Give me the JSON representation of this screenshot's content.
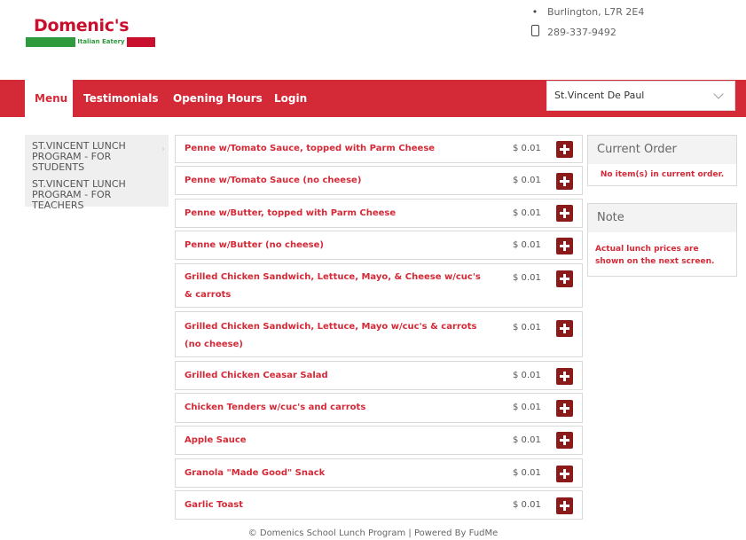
{
  "header": {
    "logo_name": "Domenic's",
    "logo_sub": "Italian Eatery",
    "address_icon": "pin-icon",
    "address": "Burlington, L7R 2E4",
    "phone_icon": "phone-icon",
    "phone": "289-337-9492"
  },
  "nav": {
    "items": [
      "Menu",
      "Testimonials",
      "Opening Hours",
      "Login"
    ],
    "location": "St.Vincent De Paul"
  },
  "sidebar": {
    "items": [
      {
        "label": "ST.VINCENT LUNCH PROGRAM - FOR STUDENTS"
      },
      {
        "label": "ST.VINCENT LUNCH PROGRAM - FOR TEACHERS"
      }
    ]
  },
  "menu": {
    "items": [
      {
        "name": "Penne w/Tomato Sauce, topped with Parm Cheese",
        "price": "$ 0.01"
      },
      {
        "name": "Penne w/Tomato Sauce (no cheese)",
        "price": "$ 0.01"
      },
      {
        "name": "Penne w/Butter, topped with Parm Cheese",
        "price": "$ 0.01"
      },
      {
        "name": "Penne w/Butter (no cheese)",
        "price": "$ 0.01"
      },
      {
        "name": "Grilled Chicken Sandwich, Lettuce, Mayo, & Cheese w/cuc's & carrots",
        "price": "$ 0.01"
      },
      {
        "name": "Grilled Chicken Sandwich, Lettuce, Mayo w/cuc's & carrots (no cheese)",
        "price": "$ 0.01"
      },
      {
        "name": "Grilled Chicken Ceasar Salad",
        "price": "$ 0.01"
      },
      {
        "name": "Chicken Tenders w/cuc's and carrots",
        "price": "$ 0.01"
      },
      {
        "name": "Apple Sauce",
        "price": "$ 0.01"
      },
      {
        "name": "Granola \"Made Good\" Snack",
        "price": "$ 0.01"
      },
      {
        "name": "Garlic Toast",
        "price": "$ 0.01"
      }
    ]
  },
  "order": {
    "title": "Current Order",
    "empty": "No item(s) in current order."
  },
  "note": {
    "title": "Note",
    "text": "Actual lunch prices are shown on the next screen."
  },
  "footer": "© Domenics School Lunch Program | Powered By FudMe",
  "colors": {
    "brand_red": "#d42a37",
    "add_button": "#8b1a1a",
    "logo_green": "#2e9a3e"
  }
}
